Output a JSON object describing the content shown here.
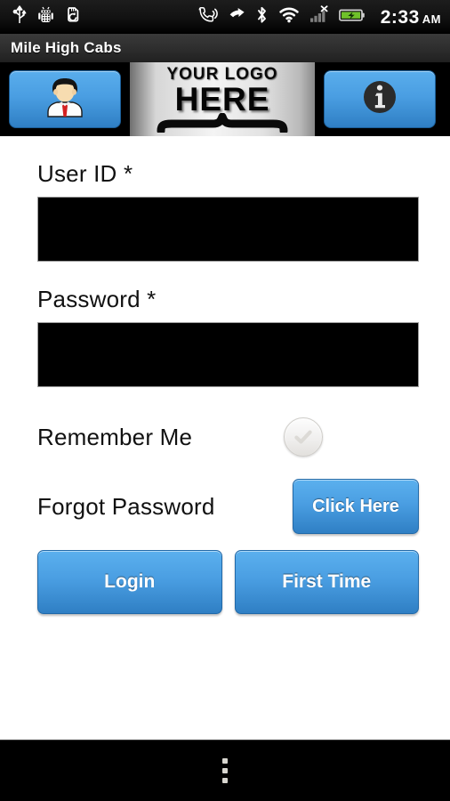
{
  "status_bar": {
    "icons_left": [
      "usb-icon",
      "android-debug-icon",
      "sdcard-sync-icon"
    ],
    "icons_right": [
      "speakerphone-icon",
      "missed-call-icon",
      "bluetooth-icon",
      "wifi-icon",
      "cell-signal-off-icon",
      "battery-charging-icon"
    ],
    "time": "2:33",
    "ampm": "AM"
  },
  "title_bar": {
    "app_title": "Mile High Cabs"
  },
  "header": {
    "account_button": {
      "icon": "user-avatar-icon"
    },
    "logo": {
      "line1": "YOUR LOGO",
      "line2": "HERE"
    },
    "info_button": {
      "icon": "info-icon",
      "glyph": "i"
    }
  },
  "form": {
    "user_id": {
      "label": "User ID *",
      "value": "",
      "placeholder": ""
    },
    "password": {
      "label": "Password *",
      "value": "",
      "placeholder": ""
    },
    "remember_me": {
      "label": "Remember Me",
      "checked": false,
      "icon": "checkmark-icon"
    },
    "forgot_password": {
      "label": "Forgot Password",
      "button_label": "Click Here"
    },
    "login_button": "Login",
    "first_time_button": "First Time"
  },
  "nav_bar": {
    "menu_icon": "overflow-menu-icon"
  },
  "colors": {
    "accent_blue": "#4a9ee2",
    "accent_blue_dark": "#2f7fc4",
    "status_bar_bg": "#111111",
    "title_bar_bg": "#2e2e2e",
    "page_bg": "#ffffff",
    "field_bg": "#000000"
  }
}
